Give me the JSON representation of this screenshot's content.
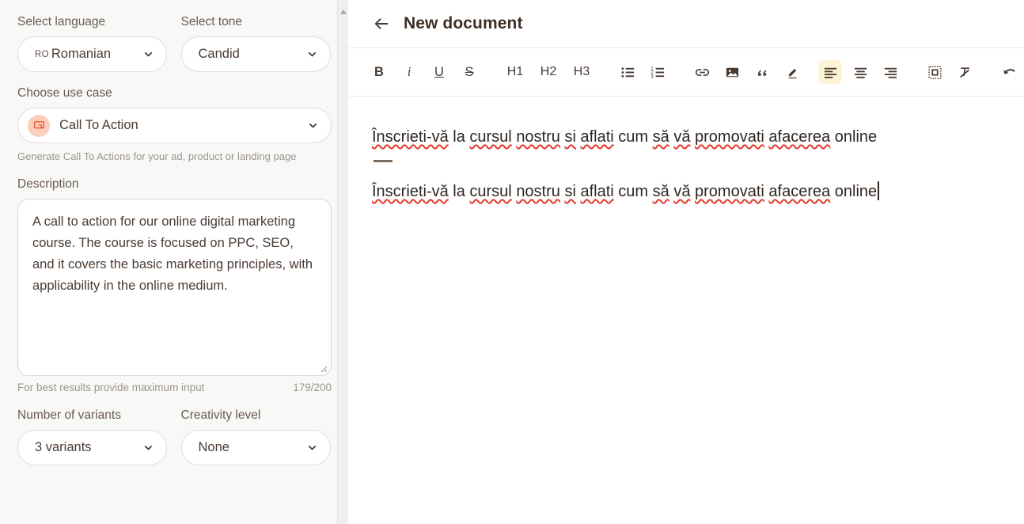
{
  "left_panel": {
    "language": {
      "label": "Select language",
      "iso": "RO",
      "value": "Romanian"
    },
    "tone": {
      "label": "Select tone",
      "value": "Candid"
    },
    "use_case": {
      "label": "Choose use case",
      "value": "Call To Action",
      "icon": "call-to-action-icon",
      "icon_bg": "#fbcdbb",
      "icon_color": "#ef5a33",
      "helper": "Generate Call To Actions for your ad, product or landing page"
    },
    "description": {
      "label": "Description",
      "value": "A call to action for our online digital marketing course. The course is focused on PPC, SEO, and it covers the basic marketing principles, with applicability in the online medium.",
      "placeholder": "",
      "hint": "For best results provide maximum input",
      "counter": "179/200"
    },
    "variants": {
      "label": "Number of variants",
      "value": "3 variants"
    },
    "creativity": {
      "label": "Creativity level",
      "value": "None"
    }
  },
  "document": {
    "back_icon": "arrow-left-icon",
    "title": "New document",
    "toolbar": [
      {
        "name": "bold-button",
        "label": "B",
        "kind": "b",
        "active": false
      },
      {
        "name": "italic-button",
        "label": "i",
        "kind": "i",
        "active": false
      },
      {
        "name": "underline-button",
        "label": "U",
        "kind": "u",
        "active": false
      },
      {
        "name": "strikethrough-button",
        "label": "S",
        "kind": "s",
        "active": false
      },
      {
        "name": "heading-1-button",
        "label": "H1",
        "kind": "h",
        "active": false
      },
      {
        "name": "heading-2-button",
        "label": "H2",
        "kind": "h",
        "active": false
      },
      {
        "name": "heading-3-button",
        "label": "H3",
        "kind": "h",
        "active": false
      },
      {
        "name": "bulleted-list-button",
        "label": "",
        "kind": "icon-ul",
        "active": false
      },
      {
        "name": "numbered-list-button",
        "label": "",
        "kind": "icon-ol",
        "active": false
      },
      {
        "name": "link-button",
        "label": "",
        "kind": "icon-link",
        "active": false
      },
      {
        "name": "image-button",
        "label": "",
        "kind": "icon-image",
        "active": false
      },
      {
        "name": "quote-button",
        "label": "",
        "kind": "icon-quote",
        "active": false
      },
      {
        "name": "highlight-button",
        "label": "",
        "kind": "icon-pencil",
        "active": false
      },
      {
        "name": "align-left-button",
        "label": "",
        "kind": "icon-align-left",
        "active": true
      },
      {
        "name": "align-center-button",
        "label": "",
        "kind": "icon-align-center",
        "active": false
      },
      {
        "name": "align-right-button",
        "label": "",
        "kind": "icon-align-right",
        "active": false
      },
      {
        "name": "insert-block-button",
        "label": "",
        "kind": "icon-block",
        "active": false
      },
      {
        "name": "clear-formatting-button",
        "label": "",
        "kind": "icon-clear",
        "active": false
      },
      {
        "name": "undo-button",
        "label": "",
        "kind": "icon-undo",
        "active": false
      }
    ],
    "content": {
      "line1": "Înscrieti-vă la cursul nostru si aflati cum să vă promovati afacerea online",
      "line2": "Înscrieti-vă la cursul nostru si aflati cum să vă promovati afacerea online",
      "spellcheck_words": [
        "Înscrieti-vă",
        "cursul",
        "nostru",
        "si",
        "aflati",
        "să",
        "vă",
        "promovati",
        "afacerea"
      ],
      "divider": true
    }
  },
  "colors": {
    "panel_bg": "#f8f8f7",
    "accent_highlight": "#fdf4d4",
    "text": "#4a3b32",
    "muted": "#9c9590",
    "spellcheck": "#e23b2e"
  }
}
